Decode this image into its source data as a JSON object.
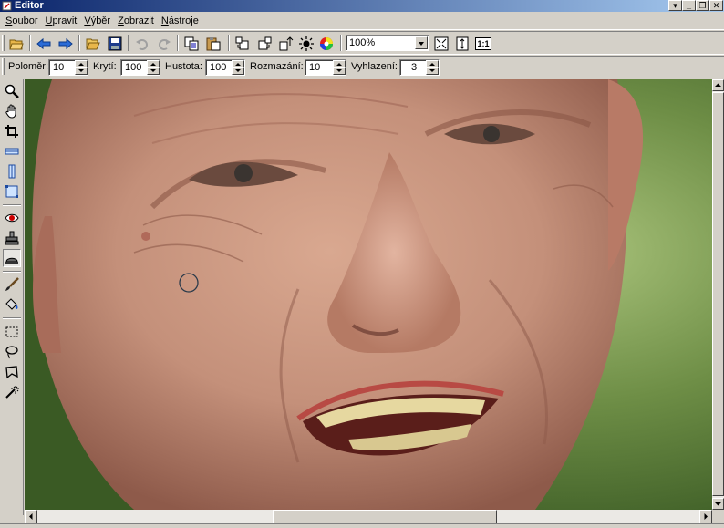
{
  "window": {
    "title": "Editor"
  },
  "menu": {
    "items": [
      {
        "label_u": "S",
        "label_rest": "oubor"
      },
      {
        "label_u": "U",
        "label_rest": "pravit"
      },
      {
        "label_u": "V",
        "label_rest": "ýběr"
      },
      {
        "label_u": "Z",
        "label_rest": "obrazit"
      },
      {
        "label_u": "N",
        "label_rest": "ástroje"
      }
    ]
  },
  "toolbar": {
    "zoom_value": "100%",
    "actual_size_label": "1:1"
  },
  "params": {
    "radius": {
      "label": "Poloměr:",
      "value": "10"
    },
    "opacity": {
      "label": "Krytí:",
      "value": "100"
    },
    "density": {
      "label": "Hustota:",
      "value": "100"
    },
    "blur": {
      "label": "Rozmazání:",
      "value": "10"
    },
    "smoothing": {
      "label": "Vyhlazení:",
      "value": "3"
    }
  },
  "colors": {
    "accent": "#0a246a",
    "chrome": "#d4d0c8"
  }
}
